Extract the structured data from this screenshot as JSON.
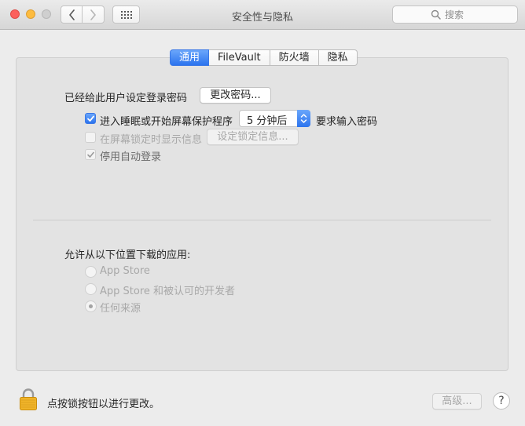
{
  "window": {
    "title": "安全性与隐私"
  },
  "search": {
    "placeholder": "搜索"
  },
  "tabs": [
    {
      "label": "通用",
      "active": true
    },
    {
      "label": "FileVault",
      "active": false
    },
    {
      "label": "防火墙",
      "active": false
    },
    {
      "label": "隐私",
      "active": false
    }
  ],
  "general": {
    "password_label": "已经给此用户设定登录密码",
    "change_password_button": "更改密码...",
    "require_password": {
      "label": "进入睡眠或开始屏幕保护程序",
      "checked": true,
      "delay_value": "5 分钟后",
      "suffix": "要求输入密码"
    },
    "lock_message": {
      "label": "在屏幕锁定时显示信息",
      "checked": false,
      "enabled": false,
      "button": "设定锁定信息..."
    },
    "disable_auto_login": {
      "label": "停用自动登录",
      "checked": true,
      "enabled": false
    }
  },
  "downloads": {
    "heading": "允许从以下位置下载的应用:",
    "options": [
      {
        "label": "App Store",
        "selected": false,
        "enabled": false
      },
      {
        "label": "App Store 和被认可的开发者",
        "selected": false,
        "enabled": false
      },
      {
        "label": "任何来源",
        "selected": true,
        "enabled": false
      }
    ]
  },
  "footer": {
    "lock_message": "点按锁按钮以进行更改。",
    "advanced_button": "高级...",
    "help_label": "?"
  },
  "colors": {
    "accent": "#2c74ee",
    "close": "#fc605c",
    "minimize": "#fdbc40",
    "lock": "#f0b429"
  }
}
